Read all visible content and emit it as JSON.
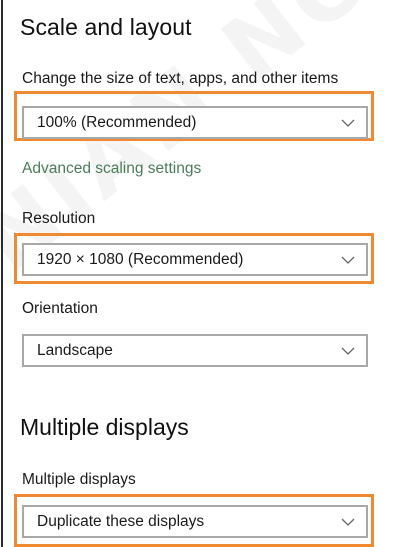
{
  "scale_section": {
    "title": "Scale and layout",
    "size_label": "Change the size of text, apps, and other items",
    "size_value": "100% (Recommended)",
    "advanced_link": "Advanced scaling settings",
    "resolution_label": "Resolution",
    "resolution_value": "1920 × 1080 (Recommended)",
    "orientation_label": "Orientation",
    "orientation_value": "Landscape"
  },
  "multiple_section": {
    "title": "Multiple displays",
    "label": "Multiple displays",
    "value": "Duplicate these displays"
  },
  "highlight_color": "#f08a32",
  "watermark": "NIAN NOVA"
}
